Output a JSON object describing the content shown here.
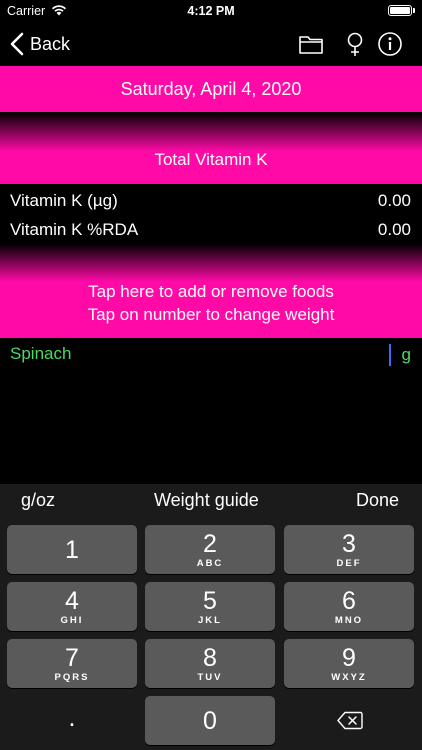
{
  "status": {
    "carrier": "Carrier",
    "time": "4:12 PM"
  },
  "nav": {
    "back_label": "Back",
    "icons": [
      "folder-icon",
      "female-symbol-icon",
      "info-icon"
    ]
  },
  "date": "Saturday, April 4, 2020",
  "total_title": "Total Vitamin K",
  "nutrients": [
    {
      "name": "Vitamin K (µg)",
      "value": "0.00"
    },
    {
      "name": "Vitamin K %RDA",
      "value": "0.00"
    }
  ],
  "add_foods": {
    "line1": "Tap here to add or remove foods",
    "line2": "Tap on number to change weight"
  },
  "food": {
    "name": "Spinach",
    "unit": "g"
  },
  "keyboard": {
    "toolbar": {
      "left": "g/oz",
      "center": "Weight guide",
      "right": "Done"
    },
    "keys": [
      {
        "digit": "1",
        "letters": ""
      },
      {
        "digit": "2",
        "letters": "ABC"
      },
      {
        "digit": "3",
        "letters": "DEF"
      },
      {
        "digit": "4",
        "letters": "GHI"
      },
      {
        "digit": "5",
        "letters": "JKL"
      },
      {
        "digit": "6",
        "letters": "MNO"
      },
      {
        "digit": "7",
        "letters": "PQRS"
      },
      {
        "digit": "8",
        "letters": "TUV"
      },
      {
        "digit": "9",
        "letters": "WXYZ"
      },
      {
        "digit": "0",
        "letters": ""
      }
    ],
    "decimal": ".",
    "delete_icon": "backspace-icon"
  },
  "colors": {
    "accent": "#ff0aa6",
    "food_green": "#4cd964",
    "key_bg": "#5a5a5a",
    "keyboard_bg": "#1b1b1b"
  }
}
